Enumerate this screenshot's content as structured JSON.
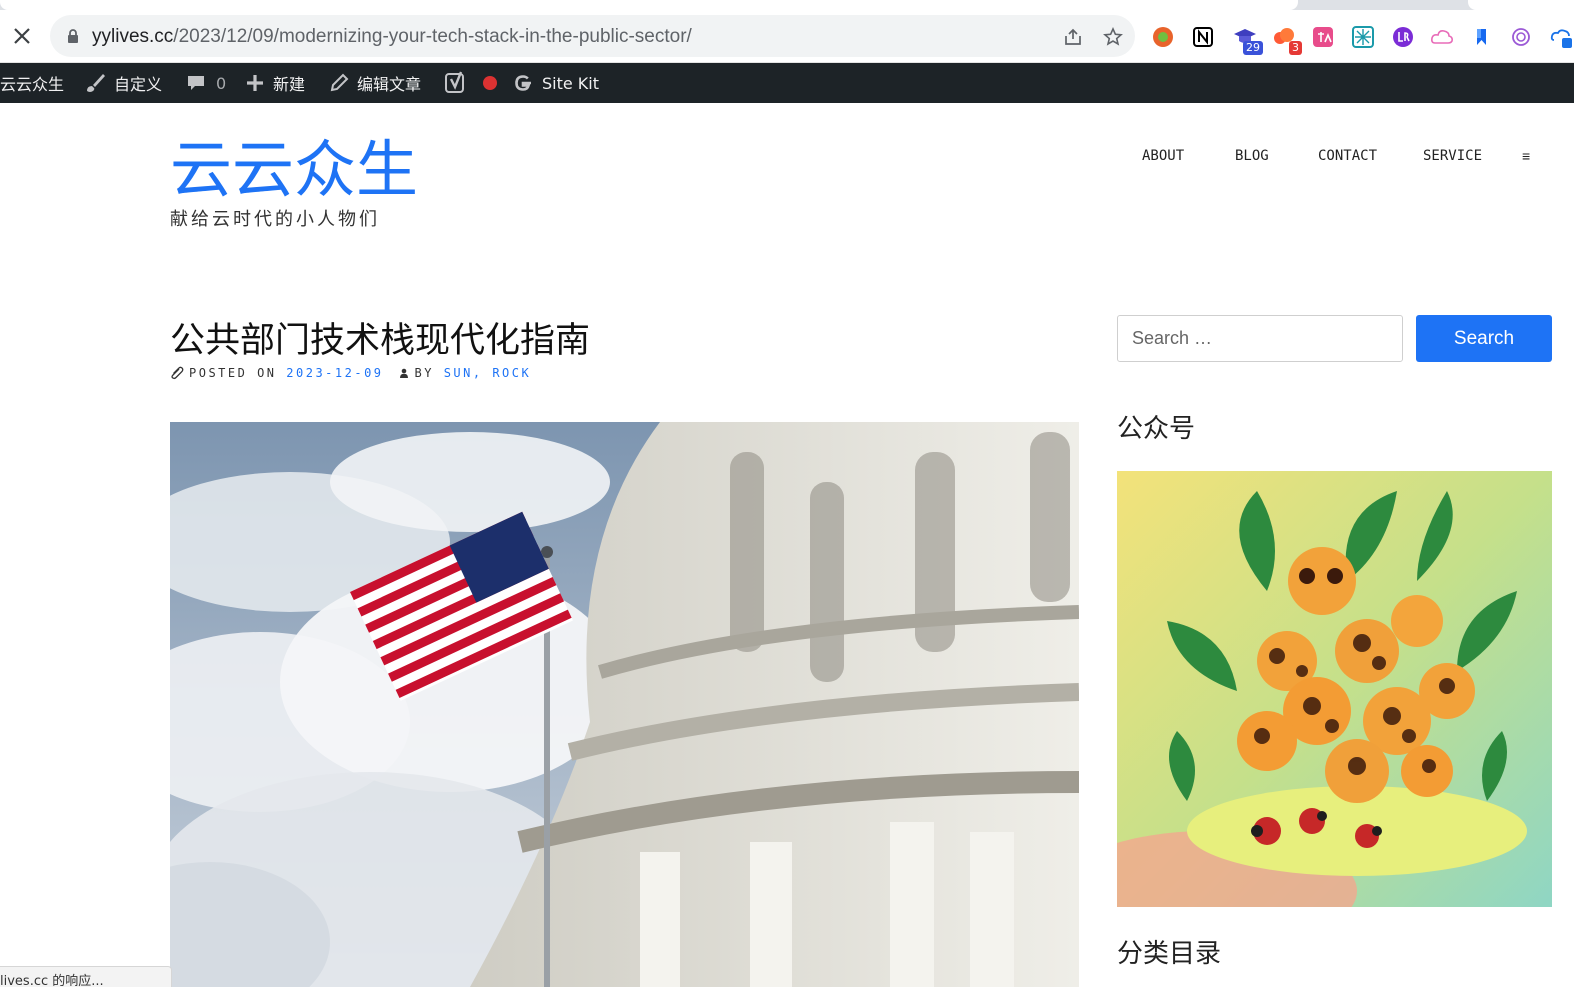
{
  "browser": {
    "url_host": "yylives.cc",
    "url_path": "/2023/12/09/modernizing-your-tech-stack-in-the-public-sector/",
    "extensions": [
      {
        "name": "chrome-extension-circle-icon",
        "color": "#e8632b"
      },
      {
        "name": "notion-icon",
        "color": "#000000"
      },
      {
        "name": "graduation-cap-extension-icon",
        "color": "#3f3fbf",
        "badge": "29",
        "badge_color": "#3a52d9"
      },
      {
        "name": "cloud-extension-icon",
        "color": "#ff5a36",
        "badge": "3",
        "badge_color": "#e53935"
      },
      {
        "name": "translate-extension-icon",
        "color": "#e84c8b"
      },
      {
        "name": "grid-extension-icon",
        "color": "#1b9aaa"
      },
      {
        "name": "lr-extension-icon",
        "color": "#7b2cd6"
      },
      {
        "name": "cloud-outline-extension-icon",
        "color": "#e86bb8"
      },
      {
        "name": "bookmark-extension-icon",
        "color": "#1769f0"
      },
      {
        "name": "openai-extension-icon",
        "color": "#9b59d6"
      },
      {
        "name": "cloud-sync-extension-icon",
        "color": "#1a73e8"
      }
    ]
  },
  "adminbar": {
    "site_name": "云云众生",
    "customize": "自定义",
    "comments_count": "0",
    "new": "新建",
    "edit_post": "编辑文章",
    "site_kit": "Site Kit"
  },
  "site": {
    "title": "云云众生",
    "description": "献给云时代的小人物们",
    "accent_color": "#1e73f5"
  },
  "nav": {
    "items": [
      "ABOUT",
      "BLOG",
      "CONTACT",
      "SERVICE"
    ],
    "menu_icon": "≡"
  },
  "post": {
    "title": "公共部门技术栈现代化指南",
    "posted_on_label": "POSTED ON",
    "date": "2023-12-09",
    "by_label": "BY",
    "author": "SUN, ROCK"
  },
  "sidebar": {
    "search_placeholder": "Search …",
    "search_button": "Search",
    "widget1_title": "公众号",
    "widget2_title": "分类目录"
  },
  "status_bar": {
    "text": "lives.cc 的响应..."
  }
}
